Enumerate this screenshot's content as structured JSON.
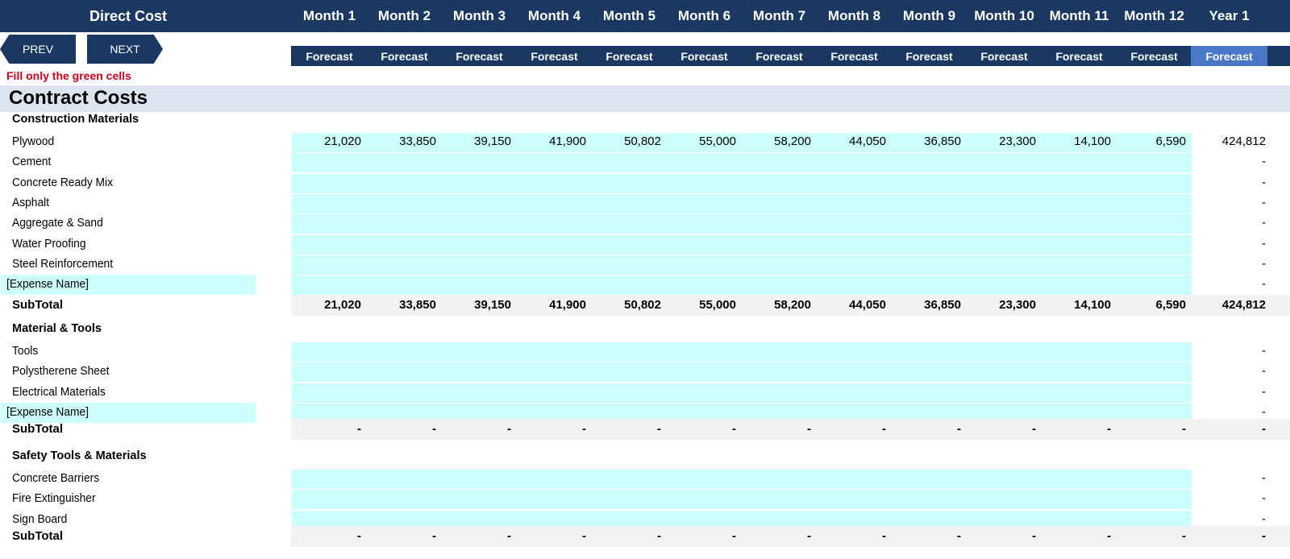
{
  "header": {
    "title": "Direct Cost",
    "periods": [
      "Month 1",
      "Month 2",
      "Month 3",
      "Month 4",
      "Month 5",
      "Month 6",
      "Month 7",
      "Month 8",
      "Month 9",
      "Month 10",
      "Month 11",
      "Month 12",
      "Year 1"
    ],
    "period_type": "Forecast"
  },
  "nav": {
    "prev_label": "PREV",
    "next_label": "NEXT"
  },
  "instruction": "Fill only the green cells",
  "section_title": "Contract Costs",
  "groups": [
    {
      "name": "Construction Materials",
      "rows": [
        {
          "label": "Plywood",
          "values": [
            "21,020",
            "33,850",
            "39,150",
            "41,900",
            "50,802",
            "55,000",
            "58,200",
            "44,050",
            "36,850",
            "23,300",
            "14,100",
            "6,590"
          ],
          "total": "424,812"
        },
        {
          "label": "Cement",
          "values": [
            "",
            "",
            "",
            "",
            "",
            "",
            "",
            "",
            "",
            "",
            "",
            ""
          ],
          "total": "-"
        },
        {
          "label": "Concrete Ready Mix",
          "values": [
            "",
            "",
            "",
            "",
            "",
            "",
            "",
            "",
            "",
            "",
            "",
            ""
          ],
          "total": "-"
        },
        {
          "label": "Asphalt",
          "values": [
            "",
            "",
            "",
            "",
            "",
            "",
            "",
            "",
            "",
            "",
            "",
            ""
          ],
          "total": "-"
        },
        {
          "label": "Aggregate & Sand",
          "values": [
            "",
            "",
            "",
            "",
            "",
            "",
            "",
            "",
            "",
            "",
            "",
            ""
          ],
          "total": "-"
        },
        {
          "label": "Water Proofing",
          "values": [
            "",
            "",
            "",
            "",
            "",
            "",
            "",
            "",
            "",
            "",
            "",
            ""
          ],
          "total": "-"
        },
        {
          "label": "Steel Reinforcement",
          "values": [
            "",
            "",
            "",
            "",
            "",
            "",
            "",
            "",
            "",
            "",
            "",
            ""
          ],
          "total": "-"
        },
        {
          "label": "[Expense Name]",
          "values": [
            "",
            "",
            "",
            "",
            "",
            "",
            "",
            "",
            "",
            "",
            "",
            ""
          ],
          "total": "-"
        }
      ],
      "subtotal_label": "SubTotal",
      "subtotal": [
        "21,020",
        "33,850",
        "39,150",
        "41,900",
        "50,802",
        "55,000",
        "58,200",
        "44,050",
        "36,850",
        "23,300",
        "14,100",
        "6,590",
        "424,812"
      ]
    },
    {
      "name": "Material & Tools",
      "rows": [
        {
          "label": "Tools",
          "values": [
            "",
            "",
            "",
            "",
            "",
            "",
            "",
            "",
            "",
            "",
            "",
            ""
          ],
          "total": "-"
        },
        {
          "label": "Polysthere ne Sheet",
          "values": [
            "",
            "",
            "",
            "",
            "",
            "",
            "",
            "",
            "",
            "",
            "",
            ""
          ],
          "total": "-"
        },
        {
          "label": "Electrical Materials",
          "values": [
            "",
            "",
            "",
            "",
            "",
            "",
            "",
            "",
            "",
            "",
            "",
            ""
          ],
          "total": "-"
        },
        {
          "label": "[Expense Name]",
          "values": [
            "",
            "",
            "",
            "",
            "",
            "",
            "",
            "",
            "",
            "",
            "",
            ""
          ],
          "total": "-"
        }
      ],
      "subtotal_label": "SubTotal",
      "subtotal": [
        "-",
        "-",
        "-",
        "-",
        "-",
        "-",
        "-",
        "-",
        "-",
        "-",
        "-",
        "-",
        "-"
      ]
    },
    {
      "name": "Safety Tools & Materials",
      "rows": [
        {
          "label": "Concrete Barriers",
          "values": [
            "",
            "",
            "",
            "",
            "",
            "",
            "",
            "",
            "",
            "",
            "",
            ""
          ],
          "total": "-"
        },
        {
          "label": "Fire Extinguisher",
          "values": [
            "",
            "",
            "",
            "",
            "",
            "",
            "",
            "",
            "",
            "",
            "",
            ""
          ],
          "total": "-"
        },
        {
          "label": "Sign Board",
          "values": [
            "",
            "",
            "",
            "",
            "",
            "",
            "",
            "",
            "",
            "",
            "",
            ""
          ],
          "total": "-"
        }
      ],
      "subtotal_label": "SubTotal",
      "subtotal": [
        "-",
        "-",
        "-",
        "-",
        "-",
        "-",
        "-",
        "-",
        "-",
        "-",
        "-",
        "-",
        "-"
      ]
    }
  ]
}
